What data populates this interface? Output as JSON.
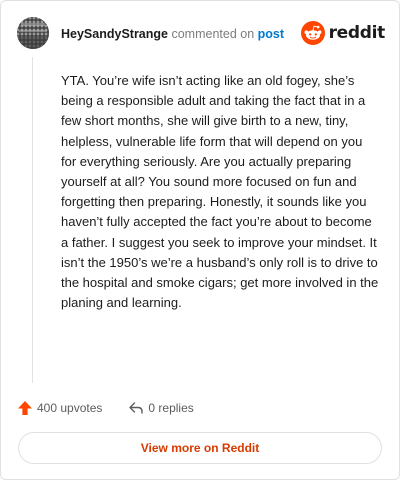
{
  "header": {
    "username": "HeySandyStrange",
    "action": "commented on",
    "post_link": "post",
    "brand": "reddit"
  },
  "comment": {
    "body": "YTA. You’re wife isn’t acting like an old fogey, she’s being a responsible adult and taking the fact that in a few short months, she will give birth to a new, tiny, helpless, vulnerable life form that will depend on you for everything seriously. Are you actually preparing yourself at all? You sound more focused on fun and forgetting then preparing. Honestly, it sounds like you haven’t fully accepted the fact you’re about to become a father. I suggest you seek to improve your mindset. It isn’t the 1950’s we’re a husband’s only roll is to drive to the hospital and smoke cigars; get more involved in the planing and learning."
  },
  "footer": {
    "upvotes": "400 upvotes",
    "replies": "0 replies"
  },
  "view_more_label": "View more on Reddit",
  "colors": {
    "brand_orange": "#ff4500",
    "link_blue": "#0079d3",
    "cta_text": "#d93a00",
    "border": "#dfe1e3"
  },
  "icons": {
    "avatar": "avatar-image",
    "logo": "reddit-snoo-icon",
    "upvote": "upvote-arrow-icon",
    "reply": "reply-arrow-icon"
  }
}
